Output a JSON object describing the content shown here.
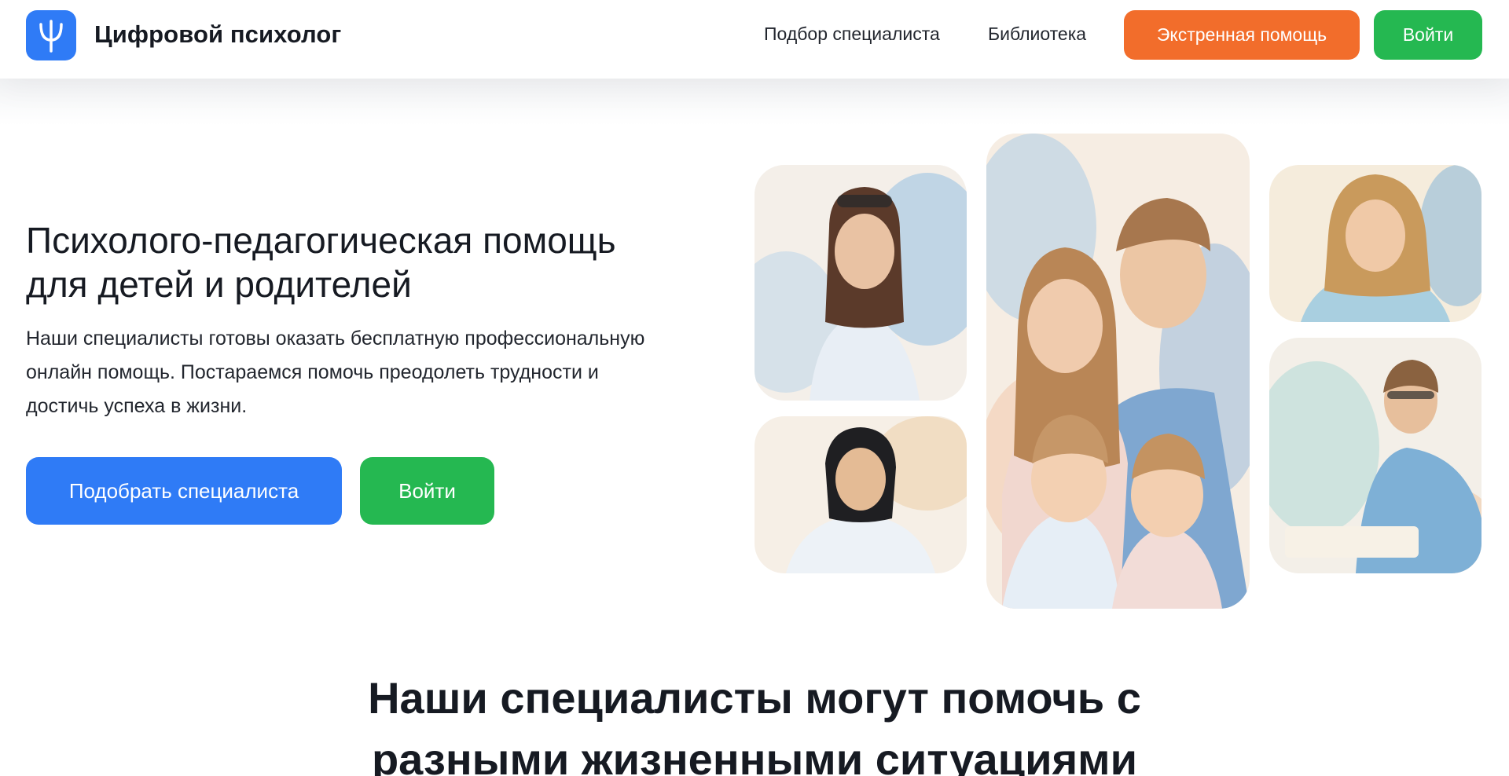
{
  "header": {
    "brand": "Цифровой психолог",
    "logo_icon": "psi-icon",
    "nav": [
      {
        "label": "Подбор специалиста"
      },
      {
        "label": "Библиотека"
      }
    ],
    "emergency_button": "Экстренная помощь",
    "login_button": "Войти"
  },
  "hero": {
    "title": "Психолого-педагогическая помощь для детей и родителей",
    "description": "Наши специалисты готовы оказать бесплатную профессиональную онлайн помощь. Постараемся помочь преодолеть трудности и достичь успеха в жизни.",
    "primary_button": "Подобрать специалиста",
    "secondary_button": "Войти"
  },
  "section": {
    "title": "Наши специалисты могут помочь с разными жизненными ситуациями"
  },
  "colors": {
    "brand_blue": "#2f7bf6",
    "emergency_orange": "#f26d2b",
    "login_green": "#25b851"
  }
}
